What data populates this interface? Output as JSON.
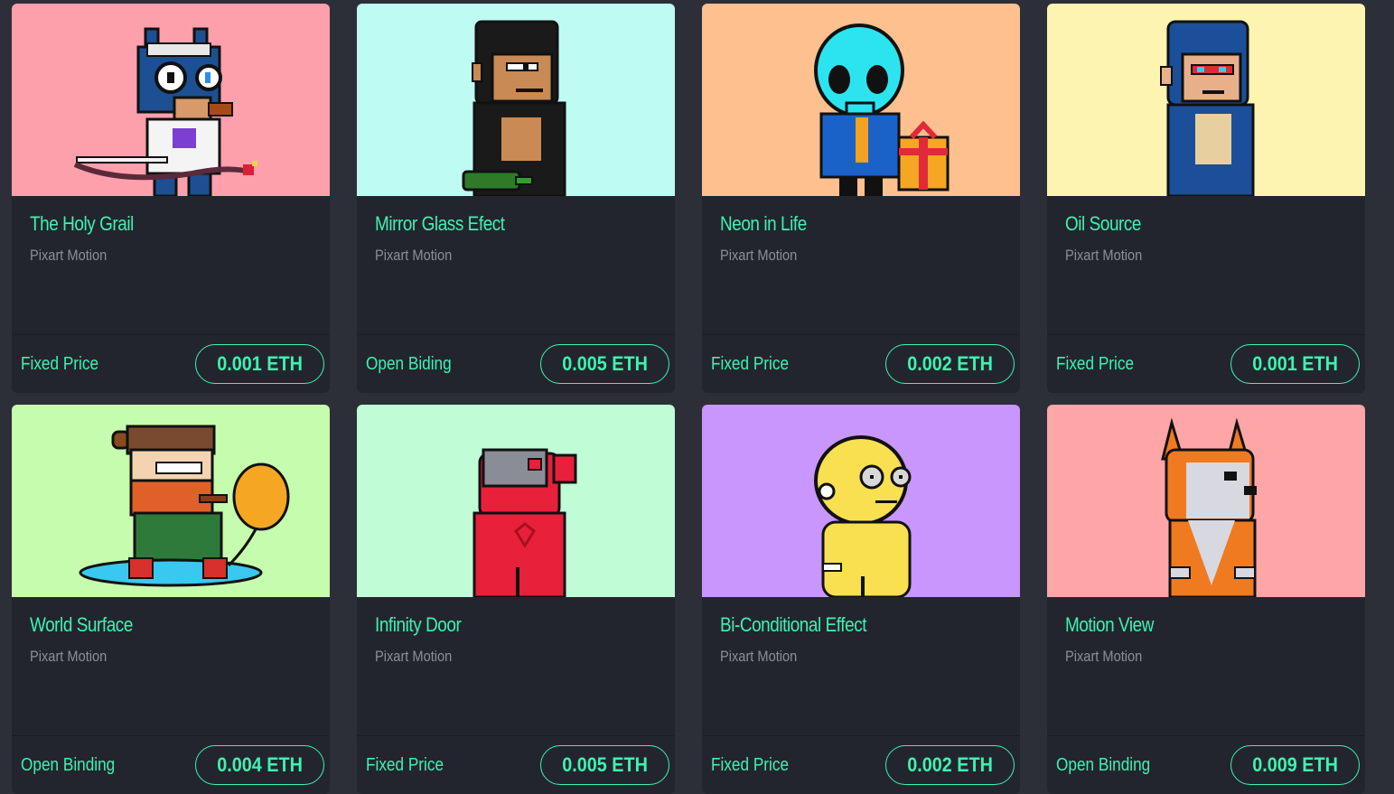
{
  "cards": [
    {
      "title": "The Holy Grail",
      "creator": "Pixart Motion",
      "sale_type": "Fixed Price",
      "price": "0.001 ETH",
      "bg": "#fe9fac",
      "art": "blue-wolf-scientist-icon"
    },
    {
      "title": "Mirror Glass Efect",
      "creator": "Pixart Motion",
      "sale_type": "Open Biding",
      "price": "0.005 ETH",
      "bg": "#befbf3",
      "art": "black-ape-icon"
    },
    {
      "title": "Neon in Life",
      "creator": "Pixart Motion",
      "sale_type": "Fixed Price",
      "price": "0.002 ETH",
      "bg": "#fdc08e",
      "art": "cyan-alien-gift-icon"
    },
    {
      "title": "Oil Source",
      "creator": "Pixart Motion",
      "sale_type": "Fixed Price",
      "price": "0.001 ETH",
      "bg": "#fef4b1",
      "art": "blue-ape-icon"
    },
    {
      "title": "World Surface",
      "creator": "Pixart Motion",
      "sale_type": "Open Binding",
      "price": "0.004 ETH",
      "bg": "#c6fcad",
      "art": "bearded-man-balloon-icon"
    },
    {
      "title": "Infinity Door",
      "creator": "Pixart Motion",
      "sale_type": "Fixed Price",
      "price": "0.005 ETH",
      "bg": "#c0fcd6",
      "art": "red-bear-vr-icon"
    },
    {
      "title": "Bi-Conditional Effect",
      "creator": "Pixart Motion",
      "sale_type": "Fixed Price",
      "price": "0.002 ETH",
      "bg": "#c896fd",
      "art": "yellow-figure-glasses-icon"
    },
    {
      "title": "Motion View",
      "creator": "Pixart Motion",
      "sale_type": "Open Binding",
      "price": "0.009 ETH",
      "bg": "#fea5a8",
      "art": "orange-fox-icon"
    }
  ],
  "colors": {
    "accent": "#3ef2b0",
    "card_bg": "#23252e",
    "page_bg": "#2d2f38",
    "muted_text": "#8d8f98"
  }
}
